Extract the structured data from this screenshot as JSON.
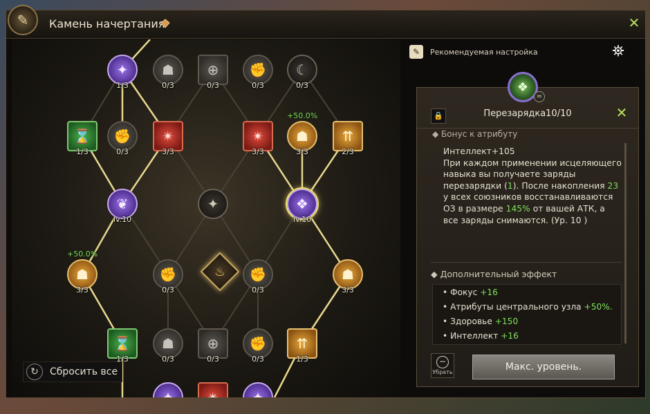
{
  "window": {
    "title": "Камень начертания",
    "close_icon": "close-x-icon"
  },
  "reset_label": "Сбросить все",
  "recommended_label": "Рекомендуемая настройка",
  "panel": {
    "title": "Перезарядка10/10",
    "section1_label": "Бонус к атрибуту",
    "stat_line": "Интеллект+105",
    "desc": {
      "p1": "При каждом применении исцеляющего навыка вы получаете заряды перезарядки (",
      "v1": "1",
      "p2": "). После накопления ",
      "v2": "23",
      "p3": " у всех союзников восстанавливаются ОЗ в размере ",
      "v3": "145%",
      "p4": " от вашей АТК, а все заряды снимаются. (Ур. 10 )"
    },
    "section2_label": "Дополнительный эффект",
    "extra": [
      {
        "name": "Фокус ",
        "value": "+16"
      },
      {
        "name": "Атрибуты центрального узла ",
        "value": "+50%."
      },
      {
        "name": "Здоровье ",
        "value": "+150"
      },
      {
        "name": "Интеллект ",
        "value": "+16"
      }
    ],
    "remove_label": "Убрать",
    "max_label": "Макс. уровень."
  },
  "tree": {
    "nodes": [
      {
        "id": "r0a",
        "shape": "circle",
        "tone": "purple",
        "icon": "compass-icon",
        "glyph": "✦",
        "level": "1/3"
      },
      {
        "id": "r0b",
        "shape": "circle",
        "tone": "gray",
        "icon": "body-icon",
        "glyph": "☗",
        "level": "0/3"
      },
      {
        "id": "r0c",
        "shape": "square",
        "tone": "gray",
        "icon": "crosshair-icon",
        "glyph": "⊕",
        "level": "0/3"
      },
      {
        "id": "r0d",
        "shape": "circle",
        "tone": "gray",
        "icon": "arm-icon",
        "glyph": "✊",
        "level": "0/3"
      },
      {
        "id": "r0e",
        "shape": "circle",
        "tone": "dark",
        "icon": "moon-icon",
        "glyph": "☾",
        "level": "0/3"
      },
      {
        "id": "r1a",
        "shape": "square",
        "tone": "green",
        "icon": "hourglass-icon",
        "glyph": "⌛",
        "level": "1/3"
      },
      {
        "id": "r1b",
        "shape": "circle",
        "tone": "gray",
        "icon": "arm-icon",
        "glyph": "✊",
        "level": "0/3"
      },
      {
        "id": "r1c",
        "shape": "square",
        "tone": "red",
        "icon": "shield-burst-icon",
        "glyph": "✴",
        "level": "3/3"
      },
      {
        "id": "r1d",
        "shape": "square",
        "tone": "red",
        "icon": "shield-burst-icon",
        "glyph": "✴",
        "level": "3/3"
      },
      {
        "id": "r1e",
        "shape": "circle",
        "tone": "orange",
        "icon": "body-icon",
        "glyph": "☗",
        "level": "3/3",
        "bonus": "+50.0%"
      },
      {
        "id": "r1f",
        "shape": "square",
        "tone": "orange",
        "icon": "arrows-up-icon",
        "glyph": "⇈",
        "level": "2/3"
      },
      {
        "id": "r2a",
        "shape": "circle",
        "tone": "purple",
        "icon": "wing-icon",
        "glyph": "❦",
        "level": "lv.10"
      },
      {
        "id": "r2b",
        "shape": "circle",
        "tone": "dark",
        "icon": "compass-icon",
        "glyph": "✦",
        "level": ""
      },
      {
        "id": "r2c",
        "shape": "circle",
        "tone": "purple",
        "icon": "heal-crystal-icon",
        "glyph": "❖",
        "level": "lv.10",
        "selected": true
      },
      {
        "id": "r3a",
        "shape": "circle",
        "tone": "orange",
        "icon": "body-icon",
        "glyph": "☗",
        "level": "3/3",
        "bonus": "+50.0%"
      },
      {
        "id": "r3b",
        "shape": "circle",
        "tone": "gray",
        "icon": "arm-icon",
        "glyph": "✊",
        "level": "0/3"
      },
      {
        "id": "r3c",
        "shape": "circle",
        "tone": "gray",
        "icon": "arm-icon",
        "glyph": "✊",
        "level": "0/3"
      },
      {
        "id": "r3d",
        "shape": "circle",
        "tone": "orange",
        "icon": "body-icon",
        "glyph": "☗",
        "level": "3/3"
      },
      {
        "id": "r4a",
        "shape": "square",
        "tone": "green",
        "icon": "hourglass-icon",
        "glyph": "⌛",
        "level": "1/3"
      },
      {
        "id": "r4b",
        "shape": "circle",
        "tone": "gray",
        "icon": "body-icon",
        "glyph": "☗",
        "level": "0/3"
      },
      {
        "id": "r4c",
        "shape": "square",
        "tone": "gray",
        "icon": "crosshair-icon",
        "glyph": "⊕",
        "level": "0/3"
      },
      {
        "id": "r4d",
        "shape": "circle",
        "tone": "gray",
        "icon": "arm-icon",
        "glyph": "✊",
        "level": "0/3"
      },
      {
        "id": "r4e",
        "shape": "square",
        "tone": "orange",
        "icon": "arrows-up-icon",
        "glyph": "⇈",
        "level": "1/3"
      },
      {
        "id": "r5a",
        "shape": "circle",
        "tone": "purple",
        "icon": "compass-icon",
        "glyph": "✦",
        "level": ""
      },
      {
        "id": "r5b",
        "shape": "square",
        "tone": "red",
        "icon": "shield-burst-icon",
        "glyph": "✴",
        "level": ""
      },
      {
        "id": "r5c",
        "shape": "circle",
        "tone": "purple",
        "icon": "compass-icon",
        "glyph": "✦",
        "level": ""
      }
    ]
  }
}
